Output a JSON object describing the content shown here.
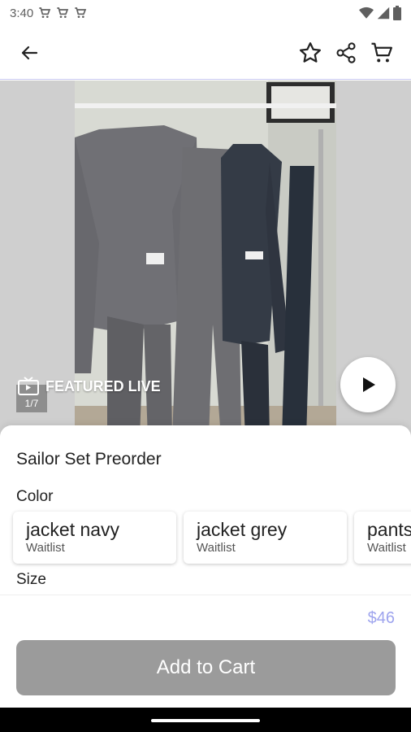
{
  "status_bar": {
    "time": "3:40"
  },
  "media": {
    "featured_label": "FEATURED LIVE",
    "counter": "1/7"
  },
  "product": {
    "title": "Sailor Set Preorder",
    "color_label": "Color",
    "variants": [
      {
        "name": "jacket navy",
        "status": "Waitlist"
      },
      {
        "name": "jacket grey",
        "status": "Waitlist"
      },
      {
        "name": "pants",
        "status": "Waitlist"
      }
    ],
    "size_label": "Size",
    "price": "$46",
    "add_to_cart_label": "Add to Cart"
  },
  "colors": {
    "price": "#9ea4ee",
    "button_disabled": "#9b9b9b",
    "app_bar_border": "#c9c9f2"
  },
  "icons": [
    "cart-icon",
    "wifi-icon",
    "signal-icon",
    "battery-icon",
    "back-arrow-icon",
    "star-icon",
    "share-icon",
    "tv-icon",
    "play-icon"
  ]
}
